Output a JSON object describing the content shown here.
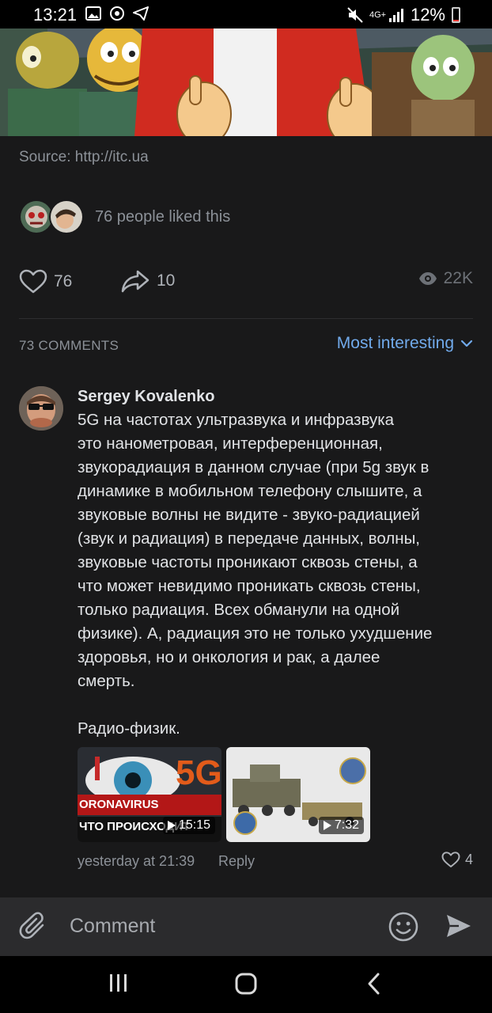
{
  "status_bar": {
    "time": "13:21",
    "network": "4G+",
    "battery": "12%",
    "battery_level": 0.12,
    "icons_left": [
      "gallery-icon",
      "app-icon",
      "telegram-icon"
    ],
    "icons_right": [
      "mute-icon",
      "network-icon",
      "signal-icon",
      "battery-icon"
    ]
  },
  "post": {
    "source": "Source: http://itc.ua",
    "likers_text": "76 people liked this",
    "likes": "76",
    "shares": "10",
    "views": "22K"
  },
  "comments_header": {
    "count": "73 COMMENTS",
    "sort": "Most interesting"
  },
  "comment": {
    "author": "Sergey Kovalenko",
    "text": "5G на частотах ультразвука и инфразвука\nэто нанометровая, интерференционная,\nзвукорадиация в данном случае (при 5g звук в\nдинамике в мобильном телефону слышите, а\nзвуковые волны не видите - звуко-радиацией\n(звук и радиация) в передаче данных, волны,\nзвуковые частоты проникают сквозь стены, а\nчто может невидимо проникать сквозь стены,\nтолько радиация. Всех обманули на одной\nфизике). А, радиация это не только ухудшение\nздоровья, но и онкология и рак, а далее\nсмерть.\n\nРадио-физик.",
    "videos": [
      {
        "duration": "15:15",
        "label_top": "ORONAVIRUS",
        "label_bottom": "ЧТО ПРОИСХОДИТ",
        "badge": "5G"
      },
      {
        "duration": "7:32"
      }
    ],
    "date": "yesterday at 21:39",
    "reply": "Reply",
    "likes": "4"
  },
  "compose": {
    "placeholder": "Comment"
  },
  "colors": {
    "background": "#19191a",
    "accent": "#71aaeb",
    "secondary_text": "#8c9198",
    "compose_bg": "#2b2b2d"
  }
}
